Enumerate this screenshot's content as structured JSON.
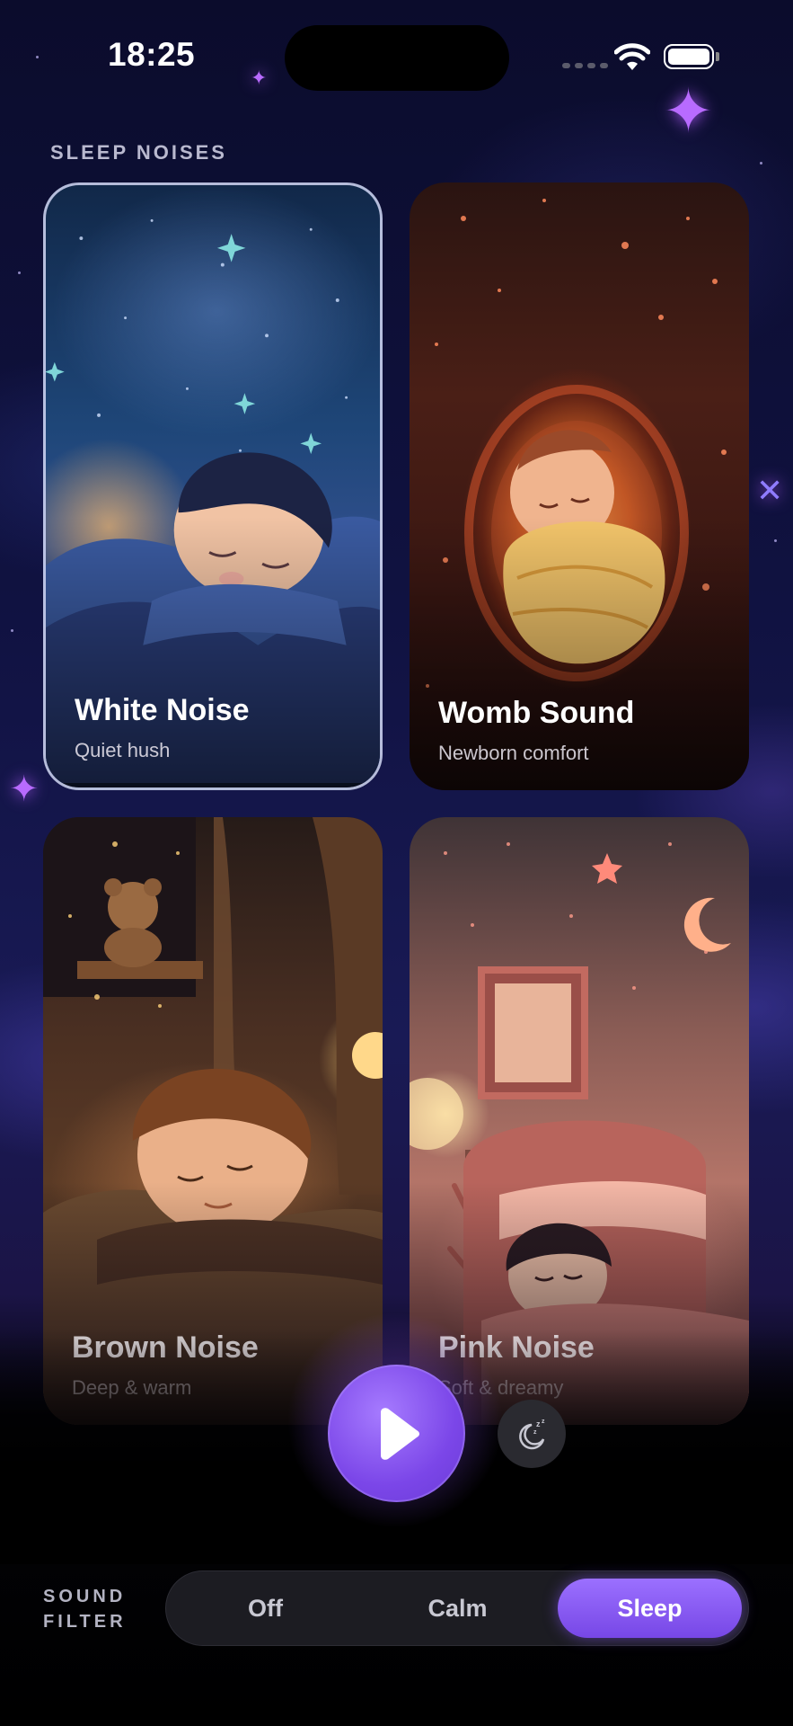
{
  "status_bar": {
    "time": "18:25"
  },
  "section_title": "SLEEP NOISES",
  "cards": [
    {
      "title": "White Noise",
      "subtitle": "Quiet hush",
      "selected": true
    },
    {
      "title": "Womb Sound",
      "subtitle": "Newborn comfort",
      "selected": false
    },
    {
      "title": "Brown Noise",
      "subtitle": "Deep & warm",
      "selected": false
    },
    {
      "title": "Pink Noise",
      "subtitle": "Soft & dreamy",
      "selected": false
    }
  ],
  "controls": {
    "play_icon": "play-icon",
    "sleep_timer_icon": "moon-zzz-icon"
  },
  "sound_filter": {
    "label_line1": "SOUND",
    "label_line2": "FILTER",
    "options": [
      "Off",
      "Calm",
      "Sleep"
    ],
    "selected": "Sleep"
  },
  "colors": {
    "accent": "#8a5cf5",
    "background": "#0b0c2c"
  }
}
